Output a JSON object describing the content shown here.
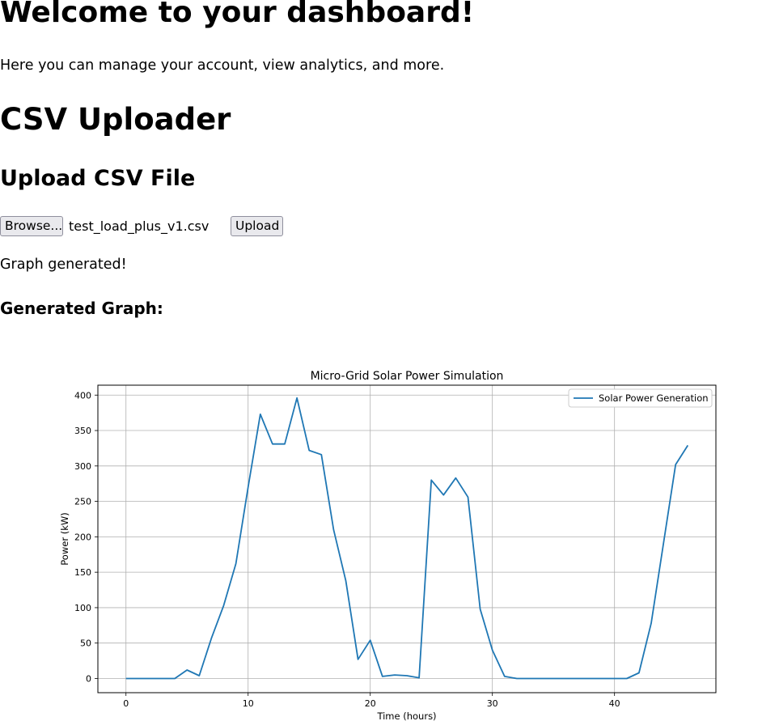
{
  "header": {
    "title": "Welcome to your dashboard!",
    "description": "Here you can manage your account, view analytics, and more."
  },
  "uploader": {
    "title": "CSV Uploader",
    "heading": "Upload CSV File",
    "browse_label": "Browse...",
    "file_name": "test_load_plus_v1.csv",
    "upload_label": "Upload",
    "status": "Graph generated!",
    "graph_heading": "Generated Graph:"
  },
  "chart_data": {
    "type": "line",
    "title": "Micro-Grid Solar Power Simulation",
    "xlabel": "Time (hours)",
    "ylabel": "Power (kW)",
    "xlim": [
      -2.3,
      48.3
    ],
    "ylim": [
      -20,
      414
    ],
    "x_ticks": [
      0,
      10,
      20,
      30,
      40
    ],
    "y_ticks": [
      0,
      50,
      100,
      150,
      200,
      250,
      300,
      350,
      400
    ],
    "grid": true,
    "legend_position": "top-right",
    "line_color": "#1f77b4",
    "series": [
      {
        "name": "Solar Power Generation",
        "x": [
          0,
          1,
          2,
          3,
          4,
          5,
          6,
          7,
          8,
          9,
          10,
          11,
          12,
          13,
          14,
          15,
          16,
          17,
          18,
          19,
          20,
          21,
          22,
          23,
          24,
          25,
          26,
          27,
          28,
          29,
          30,
          31,
          32,
          33,
          34,
          35,
          36,
          37,
          38,
          39,
          40,
          41,
          42,
          43,
          44,
          45,
          46
        ],
        "values": [
          0,
          0,
          0,
          0,
          0,
          12,
          4,
          57,
          103,
          162,
          270,
          373,
          331,
          331,
          396,
          322,
          316,
          210,
          138,
          27,
          54,
          3,
          5,
          4,
          1,
          280,
          259,
          283,
          256,
          98,
          40,
          3,
          0,
          0,
          0,
          0,
          0,
          0,
          0,
          0,
          0,
          0,
          8,
          78,
          190,
          302,
          329
        ]
      }
    ]
  }
}
